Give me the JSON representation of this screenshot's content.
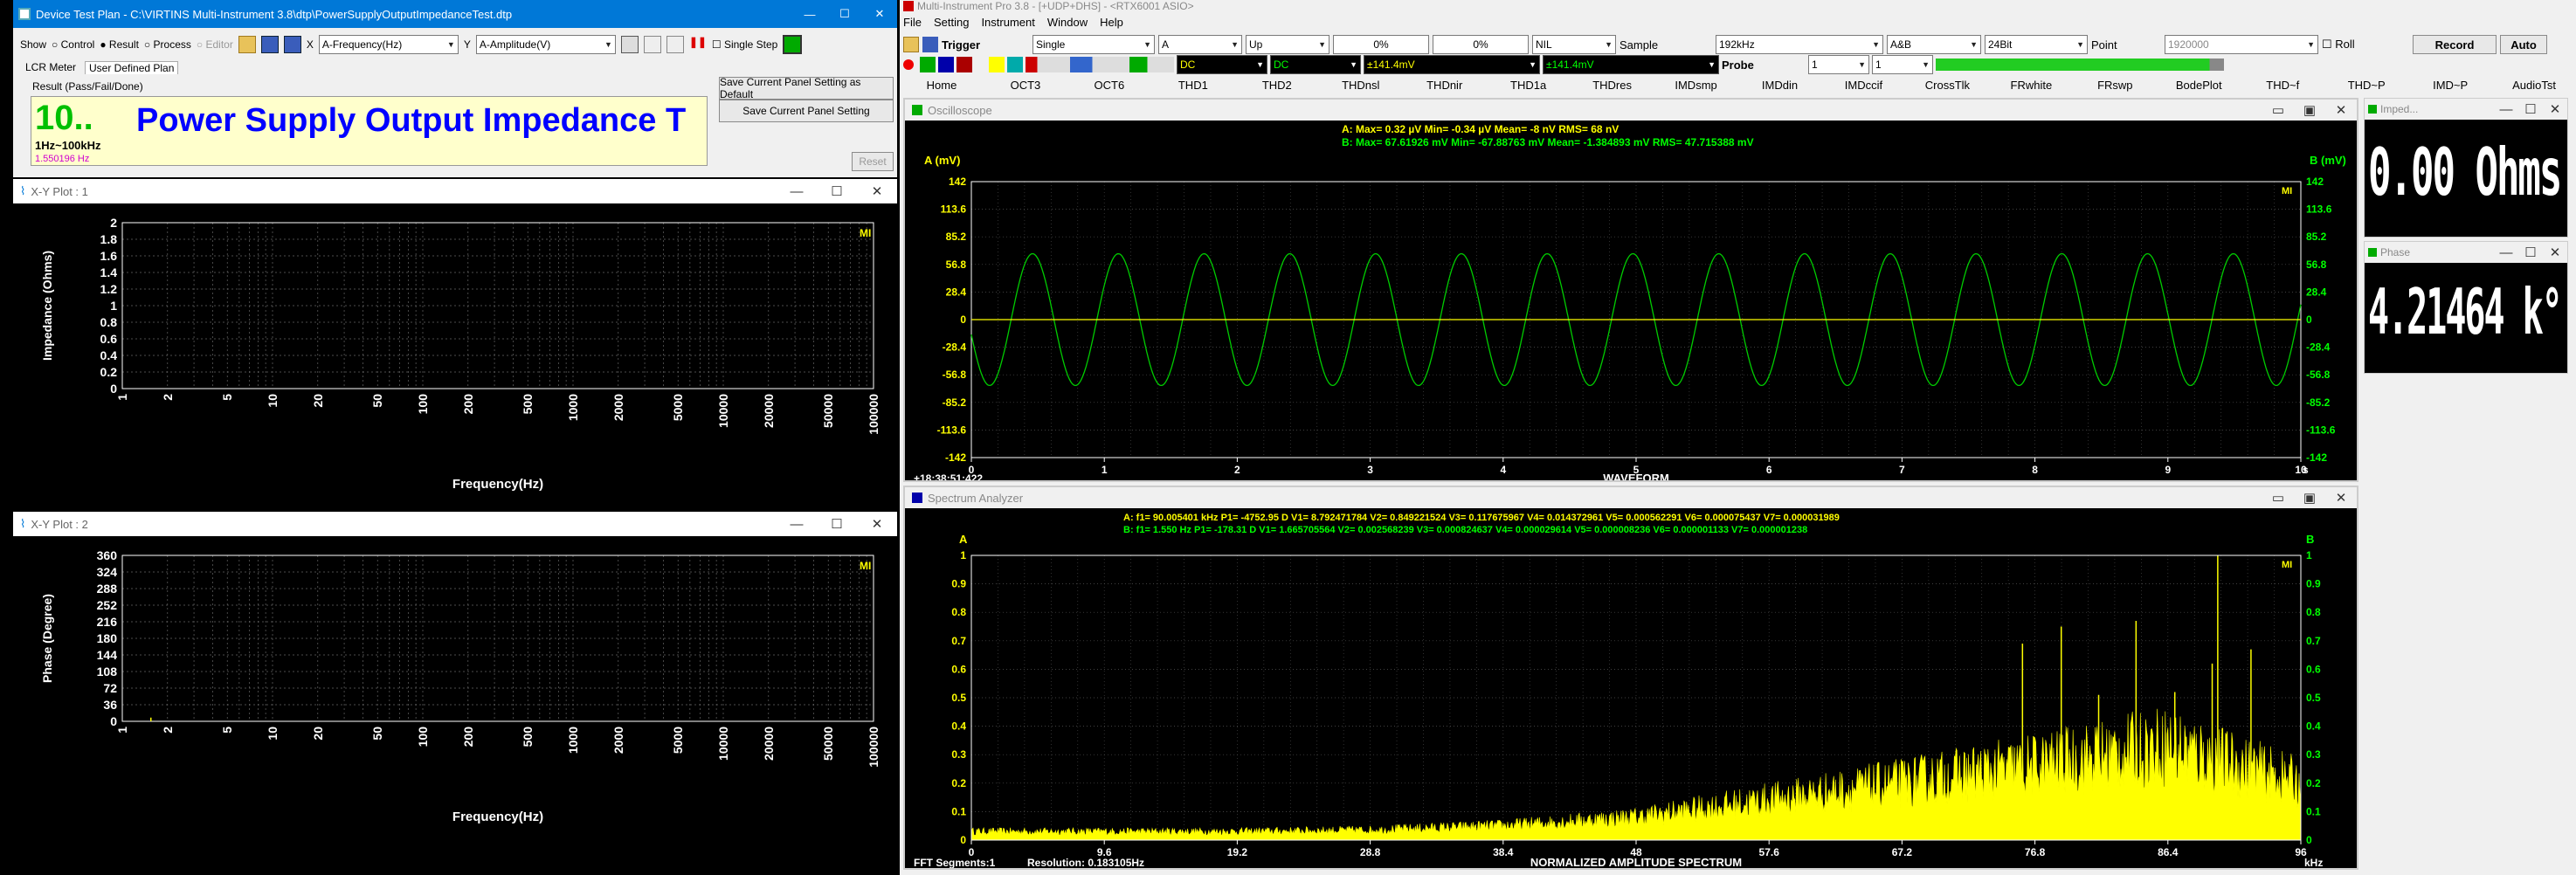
{
  "dtp": {
    "title": "Device Test Plan - C:\\VIRTINS Multi-Instrument 3.8\\dtp\\PowerSupplyOutputImpedanceTest.dtp",
    "show_label": "Show",
    "modes": [
      "Control",
      "Result",
      "Process",
      "Editor"
    ],
    "x_label": "X",
    "x_value": "A-Frequency(Hz)",
    "y_label": "Y",
    "y_value": "A-Amplitude(V)",
    "single_step": "Single Step",
    "tabs": [
      "LCR Meter",
      "User Defined Plan"
    ],
    "result_label": "Result (Pass/Fail/Done)",
    "result_value": "10..",
    "result_title": "Power Supply Output Impedance T",
    "range": "1Hz~100kHz",
    "freq_line": "1.550196 Hz",
    "save_default": "Save Current Panel Setting as Default",
    "save_setting": "Save Current Panel Setting",
    "reset": "Reset"
  },
  "xy1": {
    "title": "X-Y Plot : 1",
    "ylabel": "Impedance (Ohms)",
    "xlabel": "Frequency(Hz)",
    "yticks": [
      "2",
      "1.8",
      "1.6",
      "1.4",
      "1.2",
      "1",
      "0.8",
      "0.6",
      "0.4",
      "0.2",
      "0"
    ],
    "xticks": [
      "1",
      "2",
      "5",
      "10",
      "20",
      "50",
      "100",
      "200",
      "500",
      "1000",
      "2000",
      "5000",
      "10000",
      "20000",
      "50000",
      "100000"
    ],
    "mi": "MI"
  },
  "xy2": {
    "title": "X-Y Plot : 2",
    "ylabel": "Phase (Degree)",
    "xlabel": "Frequency(Hz)",
    "yticks": [
      "360",
      "324",
      "288",
      "252",
      "216",
      "180",
      "144",
      "108",
      "72",
      "36",
      "0"
    ],
    "xticks": [
      "1",
      "2",
      "5",
      "10",
      "20",
      "50",
      "100",
      "200",
      "500",
      "1000",
      "2000",
      "5000",
      "10000",
      "20000",
      "50000",
      "100000"
    ],
    "mi": "MI"
  },
  "mi": {
    "title": "Multi-Instrument Pro 3.8  -  [+UDP+DHS]  -  <RTX6001 ASIO>",
    "menu": [
      "File",
      "Setting",
      "Instrument",
      "Window",
      "Help"
    ],
    "mode": "Single",
    "trigger": "Trigger",
    "channel": "A",
    "edge": "Up",
    "pct1": "0%",
    "pct2": "0%",
    "nil": "NIL",
    "sample": "Sample",
    "rate": "192kHz",
    "ab": "A&B",
    "bits": "24Bit",
    "point": "Point",
    "points": "1920000",
    "roll": "Roll",
    "record": "Record",
    "auto": "Auto",
    "dc_a": "DC",
    "dc_b": "DC",
    "range_a": "±141.4mV",
    "range_b": "±141.4mV",
    "probe": "Probe",
    "probe_a": "1",
    "probe_b": "1",
    "tabs": [
      "Home",
      "OCT3",
      "OCT6",
      "THD1",
      "THD2",
      "THDnsl",
      "THDnir",
      "THD1a",
      "THDres",
      "IMDsmp",
      "IMDdin",
      "IMDccif",
      "CrossTlk",
      "FRwhite",
      "FRswp",
      "BodePlot",
      "THD~f",
      "THD~P",
      "IMD~P",
      "AudioTst"
    ]
  },
  "osc": {
    "title": "Oscilloscope",
    "stats_a": "A: Max=        0.32  µV  Min=       -0.34  µV  Mean=         -8  nV  RMS=         68  nV",
    "stats_b": "B: Max=    67.61926 mV  Min=   -67.88763 mV  Mean=   -1.384893 mV  RMS=    47.715388 mV",
    "unit_a": "A (mV)",
    "unit_b": "B (mV)",
    "yticks": [
      "142",
      "113.6",
      "85.2",
      "56.8",
      "28.4",
      "0",
      "-28.4",
      "-56.8",
      "-85.2",
      "-113.6",
      "-142"
    ],
    "xticks": [
      "0",
      "1",
      "2",
      "3",
      "4",
      "5",
      "6",
      "7",
      "8",
      "9",
      "10"
    ],
    "xunit": "s",
    "time": "+18:38:51:422",
    "footer": "WAVEFORM",
    "mi": "MI"
  },
  "spec": {
    "title": "Spectrum Analyzer",
    "stats_a": "A: f1=     90.005401   kHz  P1=  -4752.95 D  V1= 8.792471784   V2= 0.849221524   V3= 0.117675967   V4= 0.014372961   V5= 0.000562291   V6= 0.000075437   V7= 0.000031989",
    "stats_b": "B: f1=          1.550     Hz  P1=   -178.31 D  V1= 1.665705564   V2= 0.002568239   V3= 0.000824637   V4= 0.000029614   V5= 0.000008236   V6= 0.000001133   V7= 0.000001238",
    "label_a": "A",
    "label_b": "B",
    "yticks": [
      "1",
      "0.9",
      "0.8",
      "0.7",
      "0.6",
      "0.5",
      "0.4",
      "0.3",
      "0.2",
      "0.1",
      "0"
    ],
    "xticks": [
      "0",
      "9.6",
      "19.2",
      "28.8",
      "38.4",
      "48",
      "57.6",
      "67.2",
      "76.8",
      "86.4",
      "96"
    ],
    "xunit": "kHz",
    "segments": "FFT Segments:1",
    "resolution": "Resolution: 0.183105Hz",
    "footer": "NORMALIZED AMPLITUDE SPECTRUM",
    "mi": "MI"
  },
  "imp": {
    "title": "Imped...",
    "value": "0.00 Ohms"
  },
  "phase": {
    "title": "Phase",
    "value": "4.21464 k°"
  },
  "chart_data": [
    {
      "type": "line",
      "title": "Oscilloscope",
      "ylabel": "A (mV)",
      "y2label": "B (mV)",
      "xlabel": "s",
      "xlim": [
        0,
        10
      ],
      "ylim": [
        -142,
        142
      ],
      "series": [
        {
          "name": "A",
          "x": [
            0,
            10
          ],
          "y": [
            0,
            0
          ]
        },
        {
          "name": "B",
          "x": [
            0,
            1,
            2,
            3,
            4,
            5,
            6,
            7,
            8,
            9,
            10
          ],
          "y": [
            0,
            -27,
            -52,
            -43,
            -5,
            20,
            55,
            36,
            -4,
            -34,
            -60
          ],
          "note_frequency_hz": 1.55,
          "amplitude_mv": 67.8
        }
      ]
    },
    {
      "type": "area",
      "title": "NORMALIZED AMPLITUDE SPECTRUM",
      "xlabel": "kHz",
      "xlim": [
        0,
        96
      ],
      "ylim": [
        0,
        1
      ],
      "series": [
        {
          "name": "A envelope",
          "x": [
            0,
            9.6,
            19.2,
            28.8,
            38.4,
            48,
            57.6,
            67.2,
            76.8,
            86.4,
            96
          ],
          "y": [
            0.03,
            0.03,
            0.03,
            0.035,
            0.05,
            0.08,
            0.14,
            0.2,
            0.26,
            0.33,
            0.2
          ]
        }
      ],
      "peaks": [
        {
          "x": 75.9,
          "y": 0.69
        },
        {
          "x": 78.7,
          "y": 0.75
        },
        {
          "x": 81.4,
          "y": 0.51
        },
        {
          "x": 84.1,
          "y": 0.77
        },
        {
          "x": 86.9,
          "y": 0.52
        },
        {
          "x": 89.6,
          "y": 0.62
        },
        {
          "x": 90.0,
          "y": 1.0
        },
        {
          "x": 92.4,
          "y": 0.67
        }
      ]
    },
    {
      "type": "line",
      "title": "X-Y Plot : 1",
      "xlabel": "Frequency(Hz)",
      "ylabel": "Impedance (Ohms)",
      "xlim": [
        1,
        100000
      ],
      "ylim": [
        0,
        2
      ],
      "xscale": "log",
      "series": []
    },
    {
      "type": "line",
      "title": "X-Y Plot : 2",
      "xlabel": "Frequency(Hz)",
      "ylabel": "Phase (Degree)",
      "xlim": [
        1,
        100000
      ],
      "ylim": [
        0,
        360
      ],
      "xscale": "log",
      "series": [
        {
          "name": "Phase",
          "x": [
            1.55
          ],
          "y": [
            8
          ]
        }
      ]
    }
  ]
}
